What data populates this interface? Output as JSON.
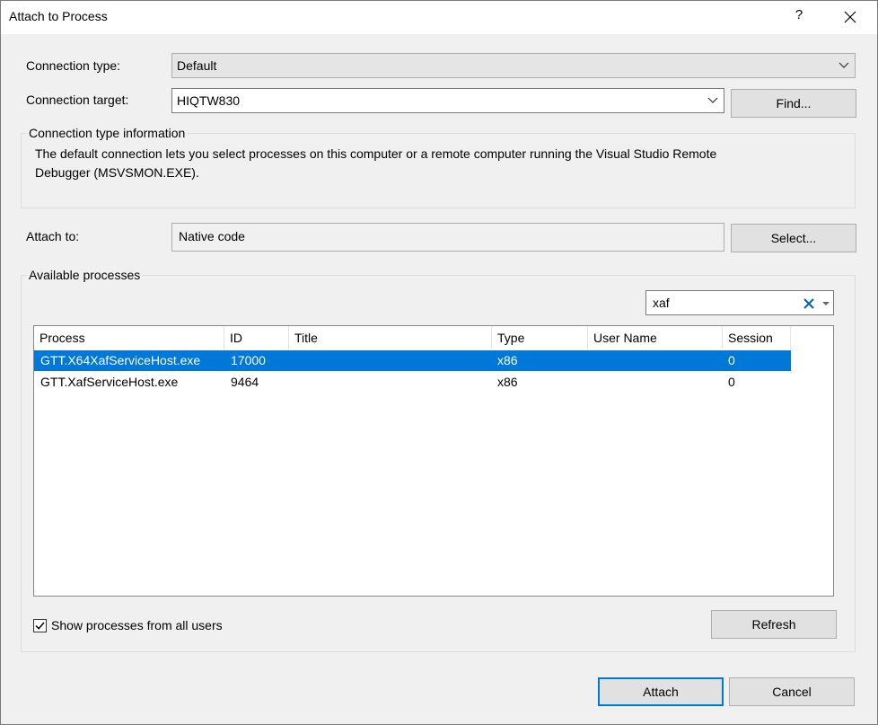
{
  "window": {
    "title": "Attach to Process",
    "help_label": "?"
  },
  "connection": {
    "type_label": "Connection type:",
    "type_value": "Default",
    "target_label": "Connection target:",
    "target_value": "HIQTW830",
    "find_button": "Find..."
  },
  "info": {
    "group_label": "Connection type information",
    "text_line1": "The default connection lets you select processes on this computer or a remote computer running the Visual Studio Remote",
    "text_line2": "Debugger (MSVSMON.EXE)."
  },
  "attach_to": {
    "label": "Attach to:",
    "value": "Native code",
    "select_button": "Select..."
  },
  "processes": {
    "group_label": "Available processes",
    "filter_value": "xaf",
    "columns": [
      "Process",
      "ID",
      "Title",
      "Type",
      "User Name",
      "Session"
    ],
    "rows": [
      {
        "process": "GTT.X64XafServiceHost.exe",
        "id": "17000",
        "title": "",
        "type": "x86",
        "user": "",
        "session": "0",
        "selected": true
      },
      {
        "process": "GTT.XafServiceHost.exe",
        "id": "9464",
        "title": "",
        "type": "x86",
        "user": "",
        "session": "0",
        "selected": false
      }
    ],
    "show_all_label": "Show processes from all users",
    "show_all_checked": true,
    "refresh_button": "Refresh"
  },
  "footer": {
    "attach_button": "Attach",
    "cancel_button": "Cancel"
  },
  "colors": {
    "selection": "#0078d7",
    "dialog_bg": "#f0f0f0",
    "clear_x": "#0063b1"
  },
  "icons": [
    "chevron-down-icon",
    "close-icon",
    "clear-filter-icon",
    "checkmark-icon"
  ]
}
